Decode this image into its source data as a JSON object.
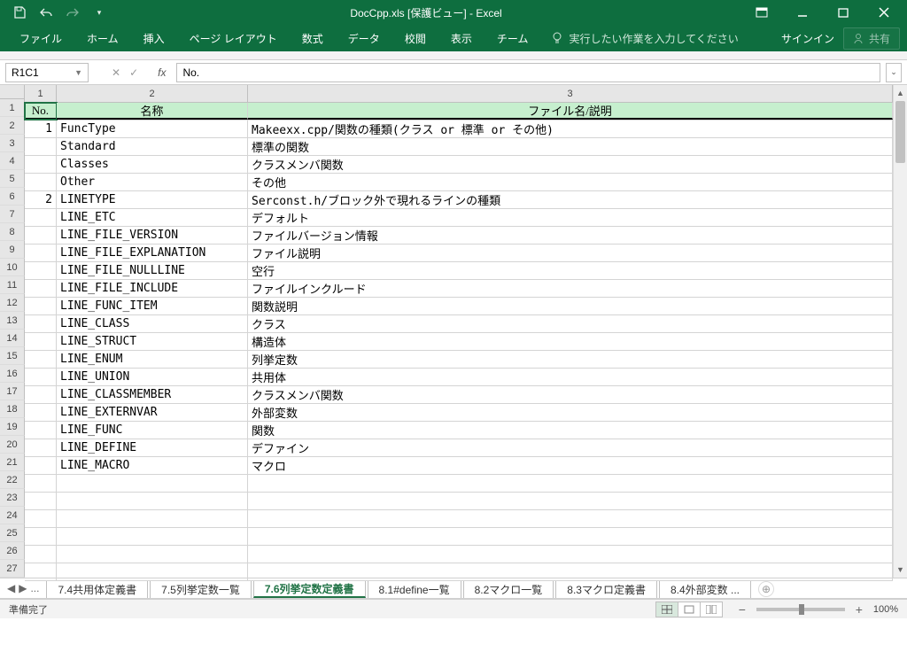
{
  "title": "DocCpp.xls [保護ビュー] - Excel",
  "ribbon": {
    "file": "ファイル",
    "tabs": [
      "ホーム",
      "挿入",
      "ページ レイアウト",
      "数式",
      "データ",
      "校閲",
      "表示",
      "チーム"
    ],
    "tellme": "実行したい作業を入力してください",
    "signin": "サインイン",
    "share": "共有"
  },
  "namebox": "R1C1",
  "formula": "No.",
  "col_numbers": [
    "1",
    "2",
    "3"
  ],
  "row_numbers": [
    "1",
    "2",
    "3",
    "4",
    "5",
    "6",
    "7",
    "8",
    "9",
    "10",
    "11",
    "12",
    "13",
    "14",
    "15",
    "16",
    "17",
    "18",
    "19",
    "20",
    "21",
    "22",
    "23",
    "24",
    "25",
    "26",
    "27"
  ],
  "headers": {
    "no": "No.",
    "name": "名称",
    "desc": "ファイル名/説明"
  },
  "rows": [
    {
      "no": "1",
      "name": "FuncType",
      "desc": "Makeexx.cpp/関数の種類(クラス or 標準 or その他)"
    },
    {
      "no": "",
      "name": "Standard",
      "desc": "標準の関数"
    },
    {
      "no": "",
      "name": "Classes",
      "desc": "クラスメンバ関数"
    },
    {
      "no": "",
      "name": "Other",
      "desc": "その他"
    },
    {
      "no": "2",
      "name": "LINETYPE",
      "desc": "Serconst.h/ブロック外で現れるラインの種類"
    },
    {
      "no": "",
      "name": "LINE_ETC",
      "desc": "デフォルト"
    },
    {
      "no": "",
      "name": "LINE_FILE_VERSION",
      "desc": "ファイルバージョン情報"
    },
    {
      "no": "",
      "name": "LINE_FILE_EXPLANATION",
      "desc": "ファイル説明"
    },
    {
      "no": "",
      "name": "LINE_FILE_NULLLINE",
      "desc": "空行"
    },
    {
      "no": "",
      "name": "LINE_FILE_INCLUDE",
      "desc": "ファイルインクルード"
    },
    {
      "no": "",
      "name": "LINE_FUNC_ITEM",
      "desc": "関数説明"
    },
    {
      "no": "",
      "name": "LINE_CLASS",
      "desc": "クラス"
    },
    {
      "no": "",
      "name": "LINE_STRUCT",
      "desc": "構造体"
    },
    {
      "no": "",
      "name": "LINE_ENUM",
      "desc": "列挙定数"
    },
    {
      "no": "",
      "name": "LINE_UNION",
      "desc": "共用体"
    },
    {
      "no": "",
      "name": "LINE_CLASSMEMBER",
      "desc": "クラスメンバ関数"
    },
    {
      "no": "",
      "name": "LINE_EXTERNVAR",
      "desc": "外部変数"
    },
    {
      "no": "",
      "name": "LINE_FUNC",
      "desc": "関数"
    },
    {
      "no": "",
      "name": "LINE_DEFINE",
      "desc": "デファイン"
    },
    {
      "no": "",
      "name": "LINE_MACRO",
      "desc": "マクロ"
    }
  ],
  "sheet_tabs": {
    "items": [
      "7.4共用体定義書",
      "7.5列挙定数一覧",
      "7.6列挙定数定義書",
      "8.1#define一覧",
      "8.2マクロ一覧",
      "8.3マクロ定義書",
      "8.4外部変数"
    ],
    "active_index": 2,
    "truncated_marker": "...",
    "nav_dots": "..."
  },
  "status": {
    "ready": "準備完了",
    "zoom": "100%"
  }
}
